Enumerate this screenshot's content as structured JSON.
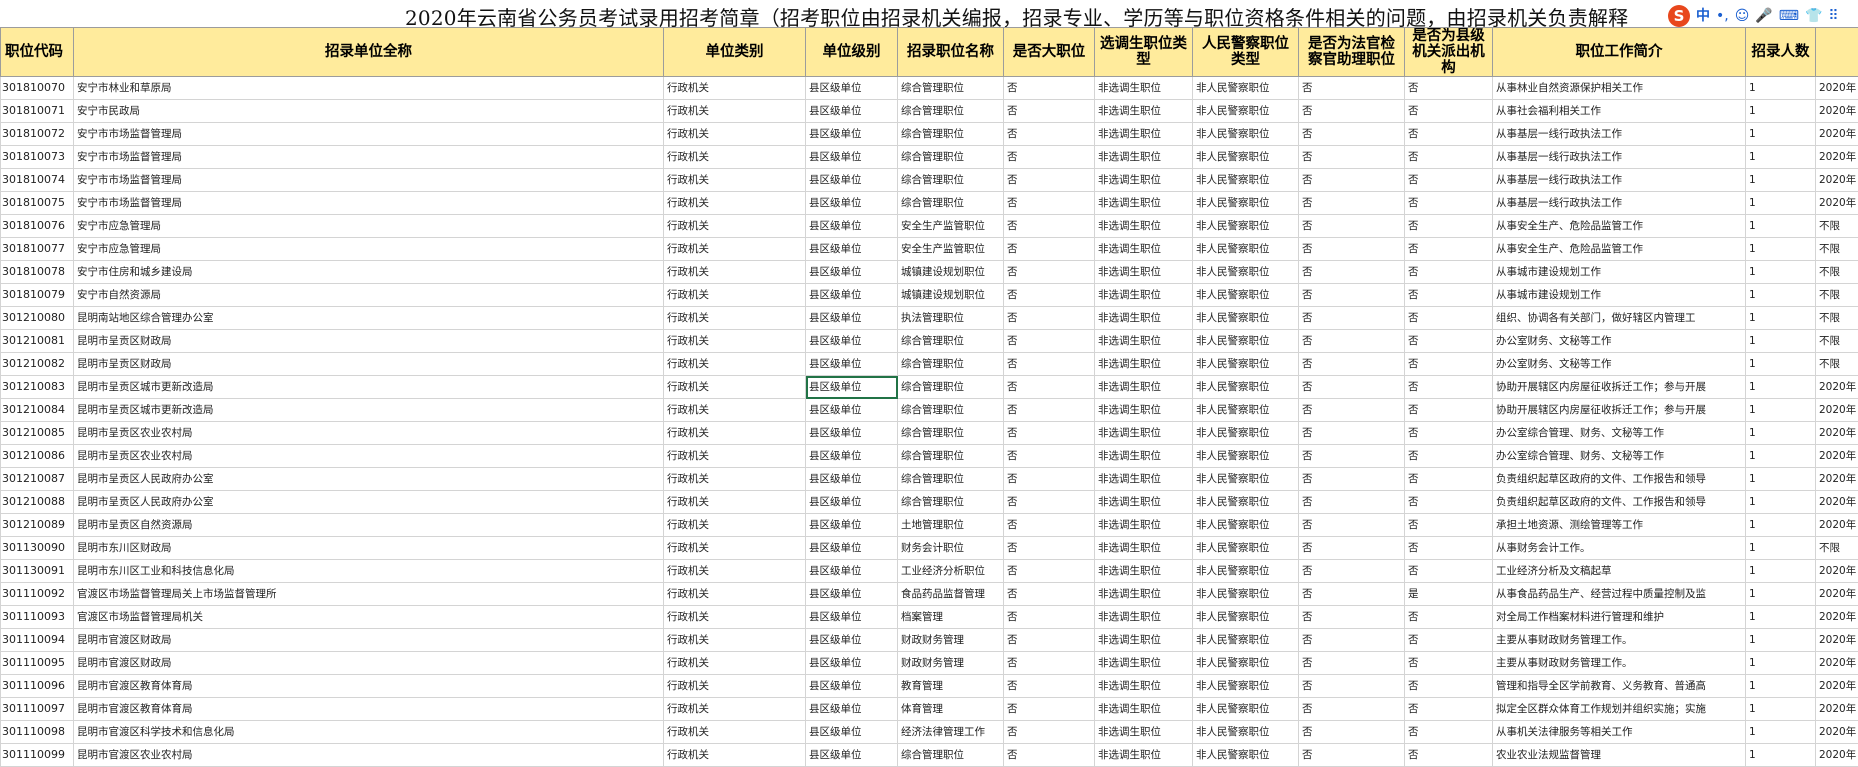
{
  "title": "2020年云南省公务员考试录用招考简章（招考职位由招录机关编报，招录专业、学历等与职位资格条件相关的问题，由招录机关负责解释",
  "ime": {
    "logo": "S",
    "lang": "中",
    "punct": "•,",
    "emoji": "☺",
    "voice": "🎤",
    "keyboard": "⌨",
    "skin": "👕",
    "grid": "⠿"
  },
  "headers": [
    "职位代码",
    "招录单位全称",
    "单位类别",
    "单位级别",
    "招录职位名称",
    "是否大职位",
    "选调生职位类型",
    "人民警察职位类型",
    "是否为法官检察官助理职位",
    "是否为县级机关派出机构",
    "职位工作简介",
    "招录人数",
    ""
  ],
  "rows": [
    [
      "301810070",
      "安宁市林业和草原局",
      "行政机关",
      "县区级单位",
      "综合管理职位",
      "否",
      "非选调生职位",
      "非人民警察职位",
      "否",
      "否",
      "从事林业自然资源保护相关工作",
      "1",
      "2020年"
    ],
    [
      "301810071",
      "安宁市民政局",
      "行政机关",
      "县区级单位",
      "综合管理职位",
      "否",
      "非选调生职位",
      "非人民警察职位",
      "否",
      "否",
      "从事社会福利相关工作",
      "1",
      "2020年"
    ],
    [
      "301810072",
      "安宁市市场监督管理局",
      "行政机关",
      "县区级单位",
      "综合管理职位",
      "否",
      "非选调生职位",
      "非人民警察职位",
      "否",
      "否",
      "从事基层一线行政执法工作",
      "1",
      "2020年"
    ],
    [
      "301810073",
      "安宁市市场监督管理局",
      "行政机关",
      "县区级单位",
      "综合管理职位",
      "否",
      "非选调生职位",
      "非人民警察职位",
      "否",
      "否",
      "从事基层一线行政执法工作",
      "1",
      "2020年"
    ],
    [
      "301810074",
      "安宁市市场监督管理局",
      "行政机关",
      "县区级单位",
      "综合管理职位",
      "否",
      "非选调生职位",
      "非人民警察职位",
      "否",
      "否",
      "从事基层一线行政执法工作",
      "1",
      "2020年"
    ],
    [
      "301810075",
      "安宁市市场监督管理局",
      "行政机关",
      "县区级单位",
      "综合管理职位",
      "否",
      "非选调生职位",
      "非人民警察职位",
      "否",
      "否",
      "从事基层一线行政执法工作",
      "1",
      "2020年"
    ],
    [
      "301810076",
      "安宁市应急管理局",
      "行政机关",
      "县区级单位",
      "安全生产监管职位",
      "否",
      "非选调生职位",
      "非人民警察职位",
      "否",
      "否",
      "从事安全生产、危险品监管工作",
      "1",
      "不限"
    ],
    [
      "301810077",
      "安宁市应急管理局",
      "行政机关",
      "县区级单位",
      "安全生产监管职位",
      "否",
      "非选调生职位",
      "非人民警察职位",
      "否",
      "否",
      "从事安全生产、危险品监管工作",
      "1",
      "不限"
    ],
    [
      "301810078",
      "安宁市住房和城乡建设局",
      "行政机关",
      "县区级单位",
      "城镇建设规划职位",
      "否",
      "非选调生职位",
      "非人民警察职位",
      "否",
      "否",
      "从事城市建设规划工作",
      "1",
      "不限"
    ],
    [
      "301810079",
      "安宁市自然资源局",
      "行政机关",
      "县区级单位",
      "城镇建设规划职位",
      "否",
      "非选调生职位",
      "非人民警察职位",
      "否",
      "否",
      "从事城市建设规划工作",
      "1",
      "不限"
    ],
    [
      "301210080",
      "昆明南站地区综合管理办公室",
      "行政机关",
      "县区级单位",
      "执法管理职位",
      "否",
      "非选调生职位",
      "非人民警察职位",
      "否",
      "否",
      "组织、协调各有关部门，做好辖区内管理工",
      "1",
      "不限"
    ],
    [
      "301210081",
      "昆明市呈贡区财政局",
      "行政机关",
      "县区级单位",
      "综合管理职位",
      "否",
      "非选调生职位",
      "非人民警察职位",
      "否",
      "否",
      "办公室财务、文秘等工作",
      "1",
      "不限"
    ],
    [
      "301210082",
      "昆明市呈贡区财政局",
      "行政机关",
      "县区级单位",
      "综合管理职位",
      "否",
      "非选调生职位",
      "非人民警察职位",
      "否",
      "否",
      "办公室财务、文秘等工作",
      "1",
      "不限"
    ],
    [
      "301210083",
      "昆明市呈贡区城市更新改造局",
      "行政机关",
      "县区级单位",
      "综合管理职位",
      "否",
      "非选调生职位",
      "非人民警察职位",
      "否",
      "否",
      "协助开展辖区内房屋征收拆迁工作；参与开展",
      "1",
      "2020年"
    ],
    [
      "301210084",
      "昆明市呈贡区城市更新改造局",
      "行政机关",
      "县区级单位",
      "综合管理职位",
      "否",
      "非选调生职位",
      "非人民警察职位",
      "否",
      "否",
      "协助开展辖区内房屋征收拆迁工作；参与开展",
      "1",
      "2020年"
    ],
    [
      "301210085",
      "昆明市呈贡区农业农村局",
      "行政机关",
      "县区级单位",
      "综合管理职位",
      "否",
      "非选调生职位",
      "非人民警察职位",
      "否",
      "否",
      "办公室综合管理、财务、文秘等工作",
      "1",
      "2020年"
    ],
    [
      "301210086",
      "昆明市呈贡区农业农村局",
      "行政机关",
      "县区级单位",
      "综合管理职位",
      "否",
      "非选调生职位",
      "非人民警察职位",
      "否",
      "否",
      "办公室综合管理、财务、文秘等工作",
      "1",
      "2020年"
    ],
    [
      "301210087",
      "昆明市呈贡区人民政府办公室",
      "行政机关",
      "县区级单位",
      "综合管理职位",
      "否",
      "非选调生职位",
      "非人民警察职位",
      "否",
      "否",
      "负责组织起草区政府的文件、工作报告和领导",
      "1",
      "2020年"
    ],
    [
      "301210088",
      "昆明市呈贡区人民政府办公室",
      "行政机关",
      "县区级单位",
      "综合管理职位",
      "否",
      "非选调生职位",
      "非人民警察职位",
      "否",
      "否",
      "负责组织起草区政府的文件、工作报告和领导",
      "1",
      "2020年"
    ],
    [
      "301210089",
      "昆明市呈贡区自然资源局",
      "行政机关",
      "县区级单位",
      "土地管理职位",
      "否",
      "非选调生职位",
      "非人民警察职位",
      "否",
      "否",
      "承担土地资源、测绘管理等工作",
      "1",
      "2020年"
    ],
    [
      "301130090",
      "昆明市东川区财政局",
      "行政机关",
      "县区级单位",
      "财务会计职位",
      "否",
      "非选调生职位",
      "非人民警察职位",
      "否",
      "否",
      "从事财务会计工作。",
      "1",
      "不限"
    ],
    [
      "301130091",
      "昆明市东川区工业和科技信息化局",
      "行政机关",
      "县区级单位",
      "工业经济分析职位",
      "否",
      "非选调生职位",
      "非人民警察职位",
      "否",
      "否",
      "工业经济分析及文稿起草",
      "1",
      "2020年"
    ],
    [
      "301110092",
      "官渡区市场监督管理局关上市场监督管理所",
      "行政机关",
      "县区级单位",
      "食品药品监督管理",
      "否",
      "非选调生职位",
      "非人民警察职位",
      "否",
      "是",
      "从事食品药品生产、经营过程中质量控制及监",
      "1",
      "2020年"
    ],
    [
      "301110093",
      "官渡区市场监督管理局机关",
      "行政机关",
      "县区级单位",
      "档案管理",
      "否",
      "非选调生职位",
      "非人民警察职位",
      "否",
      "否",
      "对全局工作档案材料进行管理和维护",
      "1",
      "2020年"
    ],
    [
      "301110094",
      "昆明市官渡区财政局",
      "行政机关",
      "县区级单位",
      "财政财务管理",
      "否",
      "非选调生职位",
      "非人民警察职位",
      "否",
      "否",
      "主要从事财政财务管理工作。",
      "1",
      "2020年"
    ],
    [
      "301110095",
      "昆明市官渡区财政局",
      "行政机关",
      "县区级单位",
      "财政财务管理",
      "否",
      "非选调生职位",
      "非人民警察职位",
      "否",
      "否",
      "主要从事财政财务管理工作。",
      "1",
      "2020年"
    ],
    [
      "301110096",
      "昆明市官渡区教育体育局",
      "行政机关",
      "县区级单位",
      "教育管理",
      "否",
      "非选调生职位",
      "非人民警察职位",
      "否",
      "否",
      "管理和指导全区学前教育、义务教育、普通高",
      "1",
      "2020年"
    ],
    [
      "301110097",
      "昆明市官渡区教育体育局",
      "行政机关",
      "县区级单位",
      "体育管理",
      "否",
      "非选调生职位",
      "非人民警察职位",
      "否",
      "否",
      "拟定全区群众体育工作规划并组织实施；实施",
      "1",
      "2020年"
    ],
    [
      "301110098",
      "昆明市官渡区科学技术和信息化局",
      "行政机关",
      "县区级单位",
      "经济法律管理工作",
      "否",
      "非选调生职位",
      "非人民警察职位",
      "否",
      "否",
      "从事机关法律服务等相关工作",
      "1",
      "2020年"
    ],
    [
      "301110099",
      "昆明市官渡区农业农村局",
      "行政机关",
      "县区级单位",
      "综合管理职位",
      "否",
      "非选调生职位",
      "非人民警察职位",
      "否",
      "否",
      "农业农业法规监督管理",
      "1",
      "2020年"
    ]
  ]
}
